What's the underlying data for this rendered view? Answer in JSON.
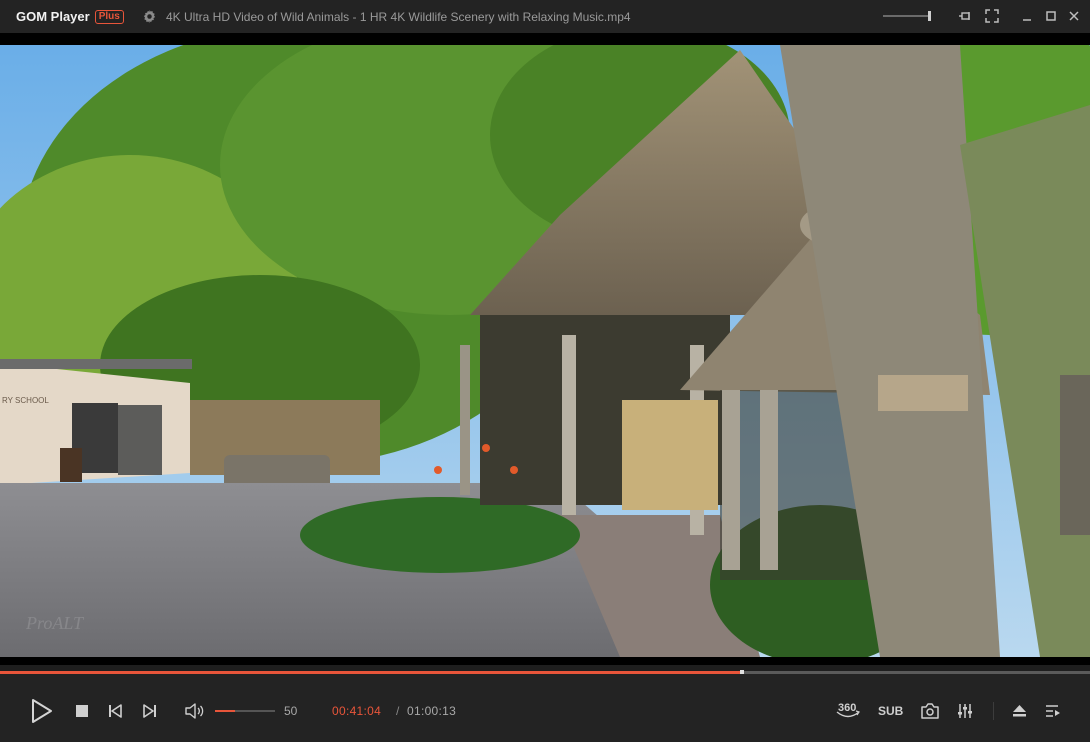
{
  "app": {
    "logo_text": "GOM Player",
    "logo_badge": "Plus",
    "window_title": "4K Ultra HD Video of Wild Animals - 1 HR 4K Wildlife Scenery with Relaxing Music.mp4"
  },
  "titlebar_icons": [
    "gear-icon",
    "pin-icon",
    "fullscreen-icon",
    "minimize-icon",
    "maximize-icon",
    "close-icon"
  ],
  "video": {
    "scene": "Thatched-roof huts among trees in a wildlife park courtyard",
    "sign_text": "RY SCHOOL",
    "watermark": "ProALT"
  },
  "playback": {
    "progress_fraction": 0.681,
    "current_time": "00:41:04",
    "separator": "/",
    "total_time": "01:00:13",
    "volume": "50",
    "volume_fraction": 0.33
  },
  "controls": {
    "left": [
      "play-icon",
      "stop-icon",
      "previous-icon",
      "next-icon",
      "volume-icon"
    ],
    "right": {
      "vr_label": "360",
      "sub_label": "SUB",
      "icons": [
        "screenshot-icon",
        "equalizer-icon",
        "eject-icon",
        "playlist-icon"
      ]
    }
  },
  "colors": {
    "accent": "#e8553a",
    "bar_bg": "#232323",
    "icon": "#cfcfcf"
  }
}
